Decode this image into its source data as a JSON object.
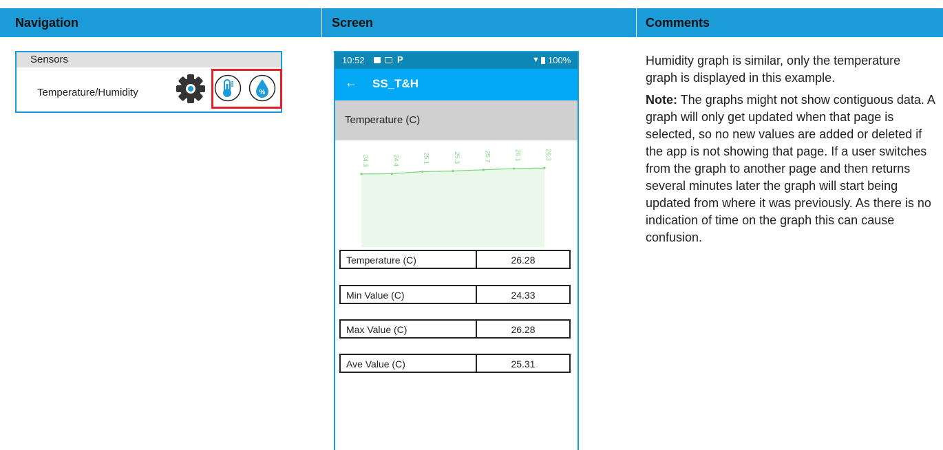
{
  "header": {
    "navigation": "Navigation",
    "screen": "Screen",
    "comments": "Comments"
  },
  "nav_panel": {
    "title": "Sensors",
    "item_label": "Temperature/Humidity",
    "icons": [
      "gear-icon",
      "thermometer-icon",
      "humidity-drop-icon"
    ]
  },
  "phone": {
    "status_time": "10:52",
    "status_battery": "100%",
    "app_title": "SS_T&H",
    "graph_title": "Temperature (C)",
    "rows": [
      {
        "label": "Temperature (C)",
        "value": "26.28"
      },
      {
        "label": "Min Value (C)",
        "value": "24.33"
      },
      {
        "label": "Max Value (C)",
        "value": "26.28"
      },
      {
        "label": "Ave Value (C)",
        "value": "25.31"
      }
    ]
  },
  "chart_data": {
    "type": "area",
    "title": "",
    "xlabel": "",
    "ylabel": "",
    "x": [
      1,
      2,
      3,
      4,
      5,
      6,
      7
    ],
    "values": [
      24.3,
      24.4,
      25.1,
      25.3,
      25.7,
      26.1,
      26.3
    ],
    "value_labels": [
      "24.3",
      "24.4",
      "25.1",
      "25.3",
      "25.7",
      "26.1",
      "26.3"
    ],
    "ylim": [
      0,
      30
    ],
    "color": "#7ed67e",
    "fill": "#eaf8ea",
    "grid": false
  },
  "comments": {
    "para1": "Humidity graph is similar, only the temperature graph is displayed in this example.",
    "note_label": "Note:",
    "note_text": " The graphs might not show contiguous data. A graph will only get updated when that page is selected, so no new values are added or deleted if the app is not showing that page. If a user switches from the graph to another page and then returns several minutes later the graph will start being updated from where it was previously. As there is no indication of time on the graph this can cause confusion."
  },
  "colors": {
    "header": "#1b9bd7",
    "highlight": "#e2202a",
    "app_bar": "#03a9f4",
    "status_bar": "#0d87b5"
  }
}
